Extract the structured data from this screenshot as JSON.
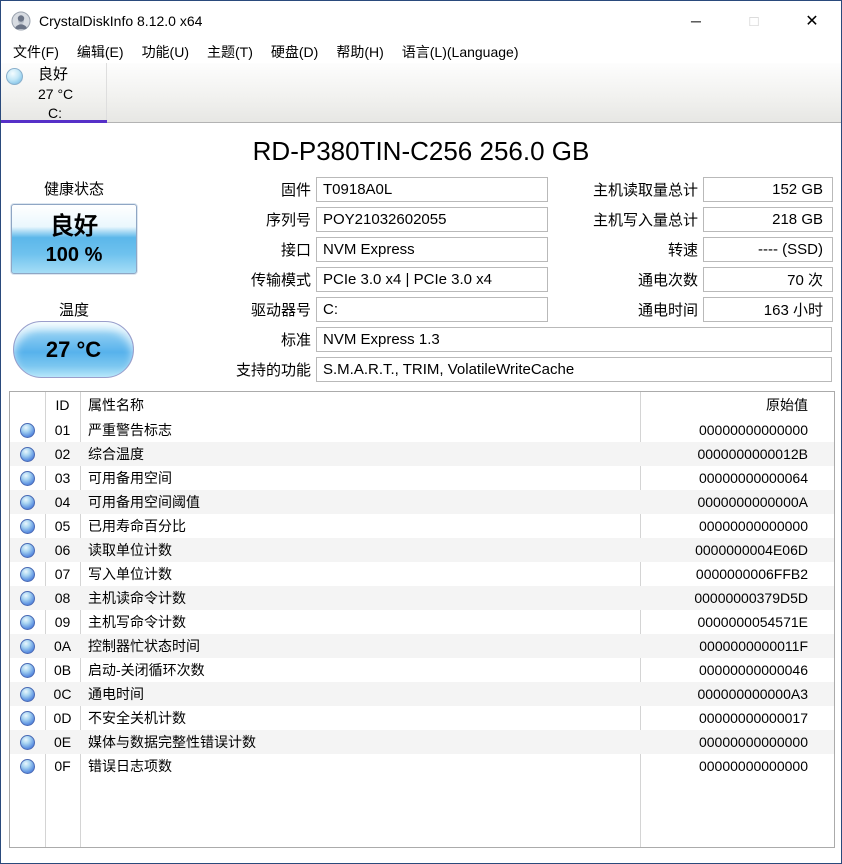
{
  "window": {
    "title": "CrystalDiskInfo 8.12.0 x64",
    "minimize_glyph": "─",
    "maximize_glyph": "□",
    "close_glyph": "✕"
  },
  "menu": {
    "items": [
      "文件(F)",
      "编辑(E)",
      "功能(U)",
      "主题(T)",
      "硬盘(D)",
      "帮助(H)",
      "语言(L)(Language)"
    ]
  },
  "drive_tab": {
    "status": "良好",
    "temperature": "27 °C",
    "letter": "C:"
  },
  "drive_info": {
    "title": "RD-P380TIN-C256 256.0 GB",
    "health_label": "健康状态",
    "health_status": "良好",
    "health_percent": "100 %",
    "temp_label": "温度",
    "temp_value": "27 °C",
    "fields_mid": [
      {
        "label": "固件",
        "value": "T0918A0L"
      },
      {
        "label": "序列号",
        "value": "POY21032602055"
      },
      {
        "label": "接口",
        "value": "NVM Express"
      },
      {
        "label": "传输模式",
        "value": "PCIe 3.0 x4 | PCIe 3.0 x4"
      },
      {
        "label": "驱动器号",
        "value": "C:"
      }
    ],
    "fields_wide": [
      {
        "label": "标准",
        "value": "NVM Express 1.3"
      },
      {
        "label": "支持的功能",
        "value": "S.M.A.R.T., TRIM, VolatileWriteCache"
      }
    ],
    "fields_right": [
      {
        "label": "主机读取量总计",
        "value": "152 GB"
      },
      {
        "label": "主机写入量总计",
        "value": "218 GB"
      },
      {
        "label": "转速",
        "value": "---- (SSD)"
      },
      {
        "label": "通电次数",
        "value": "70 次"
      },
      {
        "label": "通电时间",
        "value": "163 小时"
      }
    ]
  },
  "smart_table": {
    "header": {
      "id": "ID",
      "name": "属性名称",
      "raw": "原始值"
    },
    "rows": [
      {
        "id": "01",
        "name": "严重警告标志",
        "raw": "00000000000000"
      },
      {
        "id": "02",
        "name": "综合温度",
        "raw": "0000000000012B"
      },
      {
        "id": "03",
        "name": "可用备用空间",
        "raw": "00000000000064"
      },
      {
        "id": "04",
        "name": "可用备用空间阈值",
        "raw": "0000000000000A"
      },
      {
        "id": "05",
        "name": "已用寿命百分比",
        "raw": "00000000000000"
      },
      {
        "id": "06",
        "name": "读取单位计数",
        "raw": "0000000004E06D"
      },
      {
        "id": "07",
        "name": "写入单位计数",
        "raw": "0000000006FFB2"
      },
      {
        "id": "08",
        "name": "主机读命令计数",
        "raw": "00000000379D5D"
      },
      {
        "id": "09",
        "name": "主机写命令计数",
        "raw": "0000000054571E"
      },
      {
        "id": "0A",
        "name": "控制器忙状态时间",
        "raw": "0000000000011F"
      },
      {
        "id": "0B",
        "name": "启动-关闭循环次数",
        "raw": "00000000000046"
      },
      {
        "id": "0C",
        "name": "通电时间",
        "raw": "000000000000A3"
      },
      {
        "id": "0D",
        "name": "不安全关机计数",
        "raw": "00000000000017"
      },
      {
        "id": "0E",
        "name": "媒体与数据完整性错误计数",
        "raw": "00000000000000"
      },
      {
        "id": "0F",
        "name": "错误日志项数",
        "raw": "00000000000000"
      }
    ]
  },
  "colors": {
    "tab_underline": "#5630c8",
    "health_button_blue": "#5bb7ea",
    "status_orb_blue": "#5a8ee0",
    "window_border": "#2a4a7c"
  }
}
